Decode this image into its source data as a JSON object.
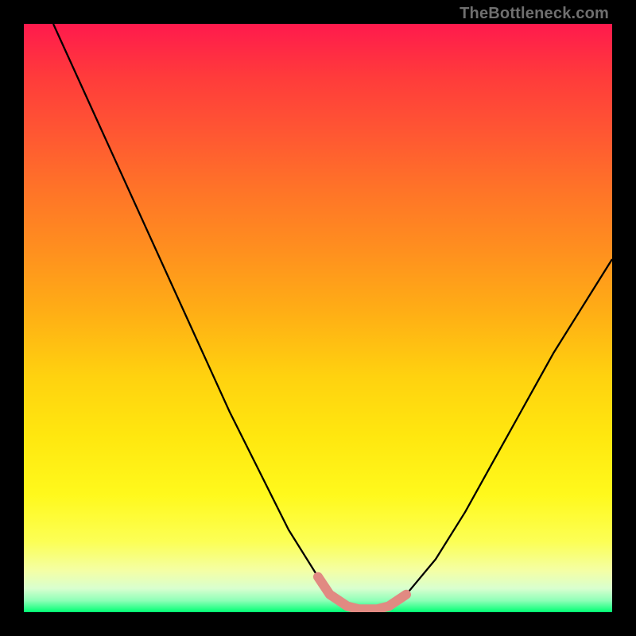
{
  "attribution": "TheBottleneck.com",
  "colors": {
    "background": "#000000",
    "curve": "#000000",
    "highlight": "#e18a82",
    "gradient_top": "#ff1a4d",
    "gradient_bottom": "#00ff73"
  },
  "chart_data": {
    "type": "line",
    "title": "",
    "xlabel": "",
    "ylabel": "",
    "xlim": [
      0,
      100
    ],
    "ylim": [
      0,
      100
    ],
    "grid": false,
    "series": [
      {
        "name": "bottleneck-curve",
        "x": [
          5,
          10,
          15,
          20,
          25,
          30,
          35,
          40,
          45,
          50,
          52,
          55,
          57,
          60,
          62,
          65,
          70,
          75,
          80,
          85,
          90,
          95,
          100
        ],
        "values": [
          100,
          89,
          78,
          67,
          56,
          45,
          34,
          24,
          14,
          6,
          3,
          1,
          0.5,
          0.5,
          1,
          3,
          9,
          17,
          26,
          35,
          44,
          52,
          60
        ]
      }
    ],
    "highlight_region": {
      "name": "optimal-range",
      "x": [
        50,
        52,
        55,
        57,
        60,
        62,
        65
      ],
      "values": [
        6,
        3,
        1,
        0.5,
        0.5,
        1,
        3
      ]
    }
  }
}
